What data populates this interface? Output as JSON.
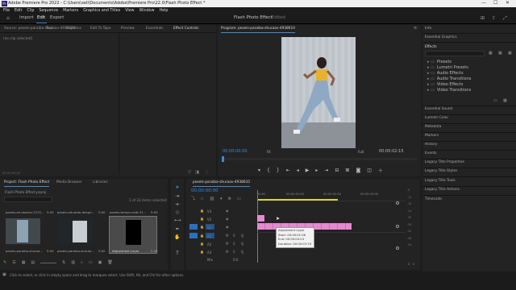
{
  "window": {
    "title": "Adobe Premiere Pro 2022 - C:\\Users\\xeli\\Documents\\Adobe\\Premiere Pro\\22.0\\Flash Photo Effect *",
    "minimize": "—",
    "maximize": "☐",
    "close": "✕"
  },
  "menu": [
    "File",
    "Edit",
    "Clip",
    "Sequence",
    "Markers",
    "Graphics and Titles",
    "View",
    "Window",
    "Help"
  ],
  "workspace": {
    "tabs": [
      "Import",
      "Edit",
      "Export"
    ],
    "project_title": "Flash Photo Effect",
    "separator": "-",
    "status": "Edited"
  },
  "source_panel": {
    "tabs": [
      "Source: pexels-paraiba-shuraav-4938610",
      "Text",
      "Captions",
      "Edit To Tape",
      "Preview",
      "Essentials",
      "Effect Controls"
    ],
    "active_tab": "Effect Controls",
    "no_clip": "(no clip selected)",
    "timecode": "00;00;00;00"
  },
  "program": {
    "title": "Program: pexels-paraiba-shuraav-4938610",
    "timecode_in": "00:00:00:00",
    "fit": "Fit",
    "full": "Full",
    "timecode_out": "00:00:02:15"
  },
  "project_panel": {
    "tabs": [
      "Project: Flash Photo Effect",
      "Media Browser",
      "Libraries"
    ],
    "path": "Flash Photo Effect.prproj",
    "selection_info": "1 of 33 items selected",
    "items": [
      {
        "name": "pexels-ali-dasilva-7215...",
        "duration": "5:00"
      },
      {
        "name": "pexels-eduardo-lempe...",
        "duration": "5:00"
      },
      {
        "name": "pexels-tempo-valtr-31...",
        "duration": "5:00"
      },
      {
        "name": "pexels-paraiba-shuraa...",
        "duration": "5:00"
      },
      {
        "name": "pexels-paraiba-shuraa...",
        "duration": "5:00"
      },
      {
        "name": "pexels-paraiba-shuraa...",
        "duration": "3:01"
      },
      {
        "name": "Adjustment Layer",
        "duration": "5:00"
      }
    ]
  },
  "timeline": {
    "tab": "pexels-paraiba-shuraav-4938610",
    "timecode": "00:00:00:00",
    "ruler": [
      "00:00",
      "00:00:01:00",
      "00:00:02:00",
      "00:00:03:00"
    ],
    "tracks": [
      "V3",
      "V2",
      "V1",
      "A1",
      "A2",
      "A3"
    ],
    "mix": "Mix",
    "mix_value": "0.0",
    "tooltip": {
      "name": "Adjustment Layer",
      "start": "Start: 00:00:01:06",
      "end": "End: 00:00:04:24",
      "duration": "Duration: 00:00:03:19"
    }
  },
  "right_panel": {
    "items": [
      "Info",
      "Essential Graphics",
      "Effects",
      "Essential Sound",
      "Lumetri Color",
      "Metadata",
      "Markers",
      "History",
      "Events",
      "Legacy Title Properties",
      "Legacy Title Styles",
      "Legacy Title Tools",
      "Legacy Title Actions",
      "Timecode"
    ],
    "effects_folders": [
      "Presets",
      "Lumetri Presets",
      "Audio Effects",
      "Audio Transitions",
      "Video Effects",
      "Video Transitions"
    ]
  },
  "status_bar": {
    "text": "Click to select, or click in empty space and drag to marquee select. Use Shift, Alt, and Ctrl for other options."
  },
  "meters": [
    "-6",
    "-12",
    "-18",
    "-24",
    "-30",
    "-36",
    "-42",
    "-48",
    "-54",
    "S",
    "S"
  ],
  "colors": {
    "accent": "#3b8ed6",
    "adjustment_clip": "#e58ad0",
    "timecode": "#3a8be0"
  }
}
